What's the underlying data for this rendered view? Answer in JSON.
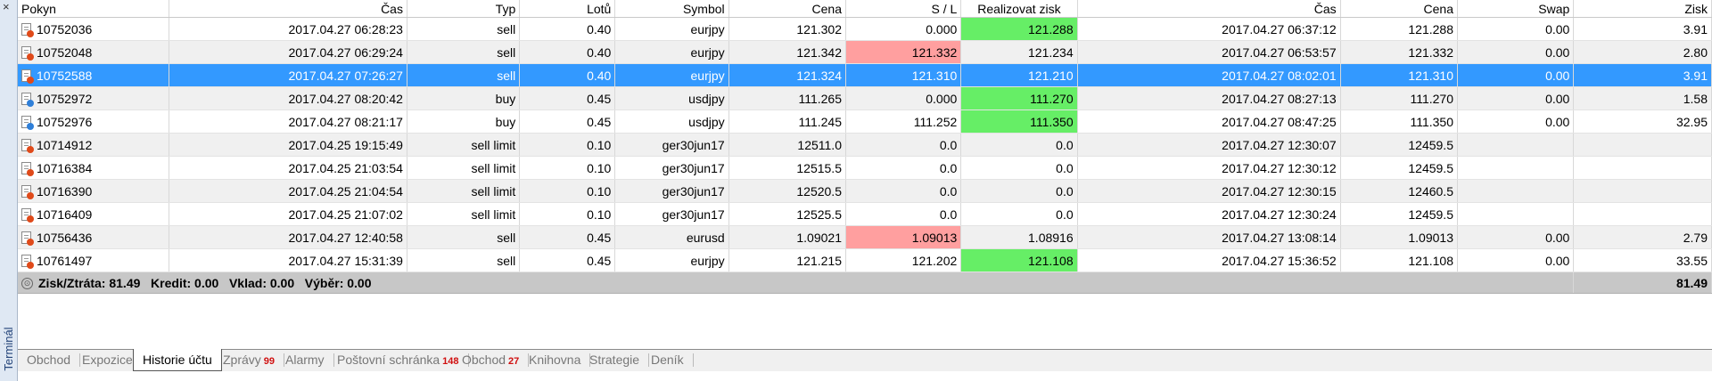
{
  "panel": {
    "title": "Terminál",
    "close_glyph": "×"
  },
  "columns": [
    "Pokyn",
    "Čas",
    "Typ",
    "Lotů",
    "Symbol",
    "Cena",
    "S / L",
    "Realizovat zisk",
    "Čas",
    "Cena",
    "Swap",
    "Zisk"
  ],
  "rows": [
    {
      "pokyn": "10752036",
      "cas": "2017.04.27 06:28:23",
      "typ": "sell",
      "lotu": "0.40",
      "symbol": "eurjpy",
      "cena": "121.302",
      "sl": "0.000",
      "tp": "121.288",
      "cas2": "2017.04.27 06:37:12",
      "cena2": "121.288",
      "swap": "0.00",
      "zisk": "3.91",
      "icon": "red",
      "sl_hl": "",
      "tp_hl": "grn",
      "selected": false
    },
    {
      "pokyn": "10752048",
      "cas": "2017.04.27 06:29:24",
      "typ": "sell",
      "lotu": "0.40",
      "symbol": "eurjpy",
      "cena": "121.342",
      "sl": "121.332",
      "tp": "121.234",
      "cas2": "2017.04.27 06:53:57",
      "cena2": "121.332",
      "swap": "0.00",
      "zisk": "2.80",
      "icon": "red",
      "sl_hl": "red",
      "tp_hl": "",
      "selected": false
    },
    {
      "pokyn": "10752588",
      "cas": "2017.04.27 07:26:27",
      "typ": "sell",
      "lotu": "0.40",
      "symbol": "eurjpy",
      "cena": "121.324",
      "sl": "121.310",
      "tp": "121.210",
      "cas2": "2017.04.27 08:02:01",
      "cena2": "121.310",
      "swap": "0.00",
      "zisk": "3.91",
      "icon": "red",
      "sl_hl": "red",
      "tp_hl": "",
      "selected": true
    },
    {
      "pokyn": "10752972",
      "cas": "2017.04.27 08:20:42",
      "typ": "buy",
      "lotu": "0.45",
      "symbol": "usdjpy",
      "cena": "111.265",
      "sl": "0.000",
      "tp": "111.270",
      "cas2": "2017.04.27 08:27:13",
      "cena2": "111.270",
      "swap": "0.00",
      "zisk": "1.58",
      "icon": "blue",
      "sl_hl": "",
      "tp_hl": "grn",
      "selected": false
    },
    {
      "pokyn": "10752976",
      "cas": "2017.04.27 08:21:17",
      "typ": "buy",
      "lotu": "0.45",
      "symbol": "usdjpy",
      "cena": "111.245",
      "sl": "111.252",
      "tp": "111.350",
      "cas2": "2017.04.27 08:47:25",
      "cena2": "111.350",
      "swap": "0.00",
      "zisk": "32.95",
      "icon": "blue",
      "sl_hl": "",
      "tp_hl": "grn",
      "selected": false
    },
    {
      "pokyn": "10714912",
      "cas": "2017.04.25 19:15:49",
      "typ": "sell limit",
      "lotu": "0.10",
      "symbol": "ger30jun17",
      "cena": "12511.0",
      "sl": "0.0",
      "tp": "0.0",
      "cas2": "2017.04.27 12:30:07",
      "cena2": "12459.5",
      "swap": "",
      "zisk": "",
      "icon": "red",
      "sl_hl": "",
      "tp_hl": "",
      "selected": false
    },
    {
      "pokyn": "10716384",
      "cas": "2017.04.25 21:03:54",
      "typ": "sell limit",
      "lotu": "0.10",
      "symbol": "ger30jun17",
      "cena": "12515.5",
      "sl": "0.0",
      "tp": "0.0",
      "cas2": "2017.04.27 12:30:12",
      "cena2": "12459.5",
      "swap": "",
      "zisk": "",
      "icon": "red",
      "sl_hl": "",
      "tp_hl": "",
      "selected": false
    },
    {
      "pokyn": "10716390",
      "cas": "2017.04.25 21:04:54",
      "typ": "sell limit",
      "lotu": "0.10",
      "symbol": "ger30jun17",
      "cena": "12520.5",
      "sl": "0.0",
      "tp": "0.0",
      "cas2": "2017.04.27 12:30:15",
      "cena2": "12460.5",
      "swap": "",
      "zisk": "",
      "icon": "red",
      "sl_hl": "",
      "tp_hl": "",
      "selected": false
    },
    {
      "pokyn": "10716409",
      "cas": "2017.04.25 21:07:02",
      "typ": "sell limit",
      "lotu": "0.10",
      "symbol": "ger30jun17",
      "cena": "12525.5",
      "sl": "0.0",
      "tp": "0.0",
      "cas2": "2017.04.27 12:30:24",
      "cena2": "12459.5",
      "swap": "",
      "zisk": "",
      "icon": "red",
      "sl_hl": "",
      "tp_hl": "",
      "selected": false
    },
    {
      "pokyn": "10756436",
      "cas": "2017.04.27 12:40:58",
      "typ": "sell",
      "lotu": "0.45",
      "symbol": "eurusd",
      "cena": "1.09021",
      "sl": "1.09013",
      "tp": "1.08916",
      "cas2": "2017.04.27 13:08:14",
      "cena2": "1.09013",
      "swap": "0.00",
      "zisk": "2.79",
      "icon": "red",
      "sl_hl": "red",
      "tp_hl": "",
      "selected": false
    },
    {
      "pokyn": "10761497",
      "cas": "2017.04.27 15:31:39",
      "typ": "sell",
      "lotu": "0.45",
      "symbol": "eurjpy",
      "cena": "121.215",
      "sl": "121.202",
      "tp": "121.108",
      "cas2": "2017.04.27 15:36:52",
      "cena2": "121.108",
      "swap": "0.00",
      "zisk": "33.55",
      "icon": "red",
      "sl_hl": "",
      "tp_hl": "grn",
      "selected": false
    }
  ],
  "summary": {
    "text": "Zisk/Ztráta: 81.49   Kredit: 0.00   Vklad: 0.00   Výběr: 0.00",
    "total": "81.49"
  },
  "tabs": [
    {
      "label": "Obchod",
      "badge": "",
      "active": false
    },
    {
      "label": "Expozice",
      "badge": "",
      "active": false
    },
    {
      "label": "Historie účtu",
      "badge": "",
      "active": true
    },
    {
      "label": "Zprávy",
      "badge": "99",
      "active": false
    },
    {
      "label": "Alarmy",
      "badge": "",
      "active": false
    },
    {
      "label": "Poštovní schránka",
      "badge": "148",
      "active": false
    },
    {
      "label": "Obchod",
      "badge": "27",
      "active": false
    },
    {
      "label": "Knihovna",
      "badge": "",
      "active": false
    },
    {
      "label": "Strategie",
      "badge": "",
      "active": false
    },
    {
      "label": "Deník",
      "badge": "",
      "active": false
    }
  ],
  "colors": {
    "selected": "#3399ff",
    "sl_hit": "#ff9f9f",
    "tp_hit": "#66ee66"
  }
}
